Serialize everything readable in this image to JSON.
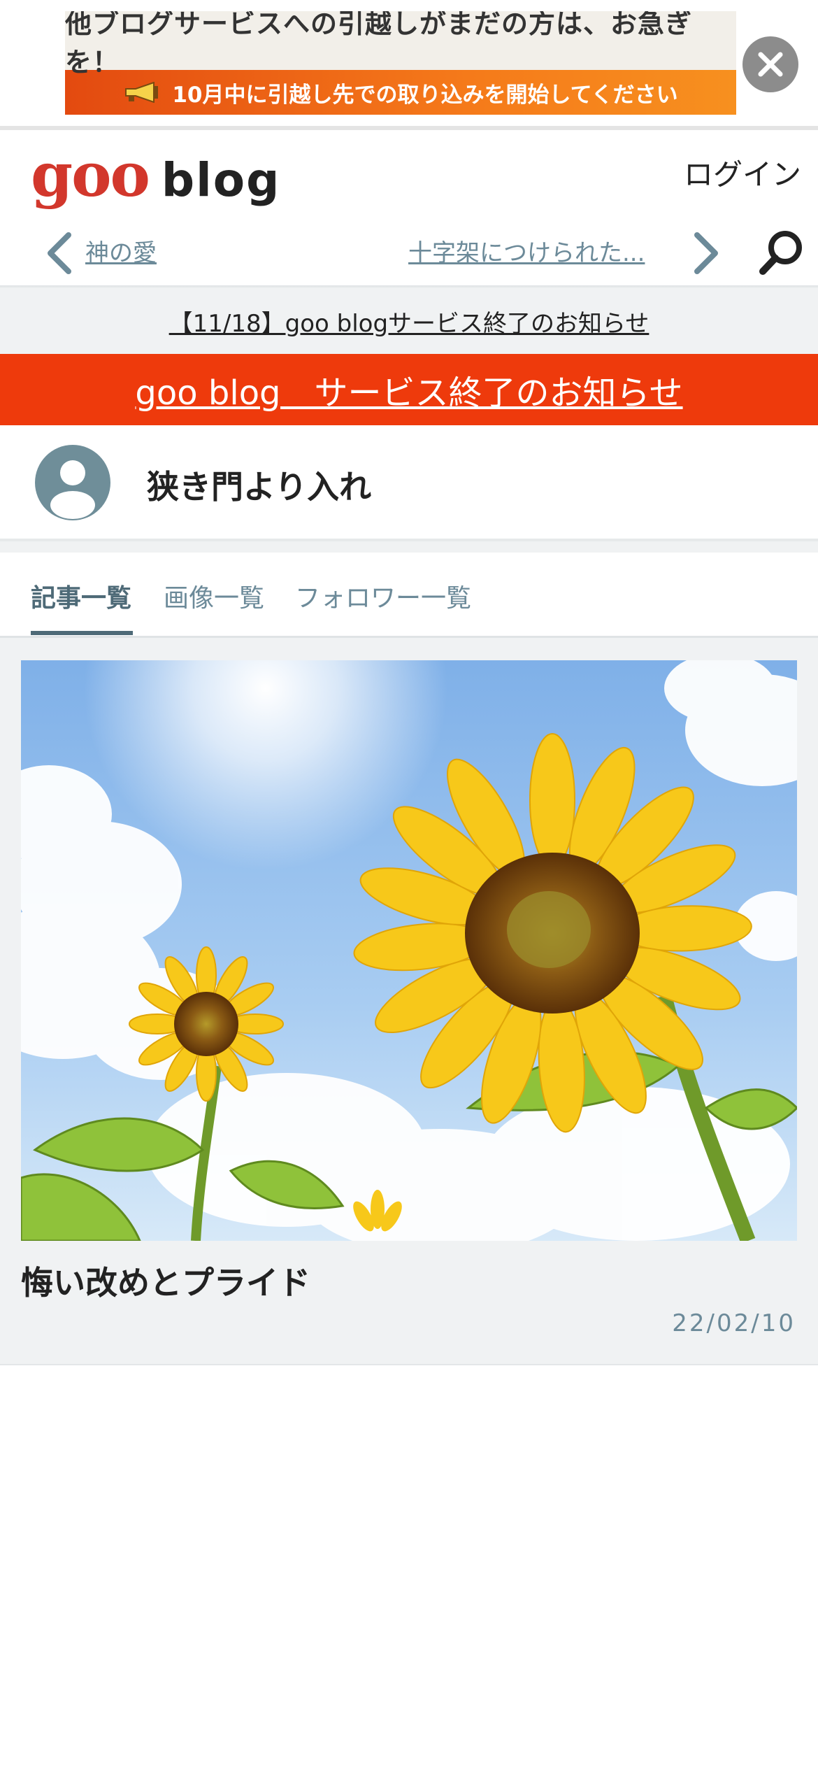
{
  "ad": {
    "line1": "他ブログサービスへの引越しがまだの方は、お急ぎを！",
    "line2": "10月中に引越し先での取り込みを開始してください",
    "close_icon": "close-icon"
  },
  "header": {
    "logo_goo": "goo",
    "logo_blog": "blog",
    "login": "ログイン"
  },
  "nav": {
    "prev_label": "神の愛",
    "next_label": "十字架につけられた...",
    "prev_icon": "chevron-left-icon",
    "next_icon": "chevron-right-icon",
    "search_icon": "search-icon"
  },
  "notice": {
    "text": "【11/18】goo blogサービス終了のお知らせ"
  },
  "red_banner": {
    "text": "goo blog　サービス終了のお知らせ"
  },
  "blog": {
    "title": "狭き門より入れ",
    "avatar_icon": "user-avatar-icon"
  },
  "tabs": [
    {
      "label": "記事一覧",
      "active": true
    },
    {
      "label": "画像一覧",
      "active": false
    },
    {
      "label": "フォロワー一覧",
      "active": false
    }
  ],
  "article": {
    "title": "悔い改めとプライド",
    "date": "22/02/10",
    "image": "sunflower-sky-image"
  },
  "colors": {
    "brand_red": "#d2372c",
    "banner_red": "#ee3a0c",
    "accent_slate": "#6c8a99",
    "ad_orange": "#f57a1a"
  }
}
